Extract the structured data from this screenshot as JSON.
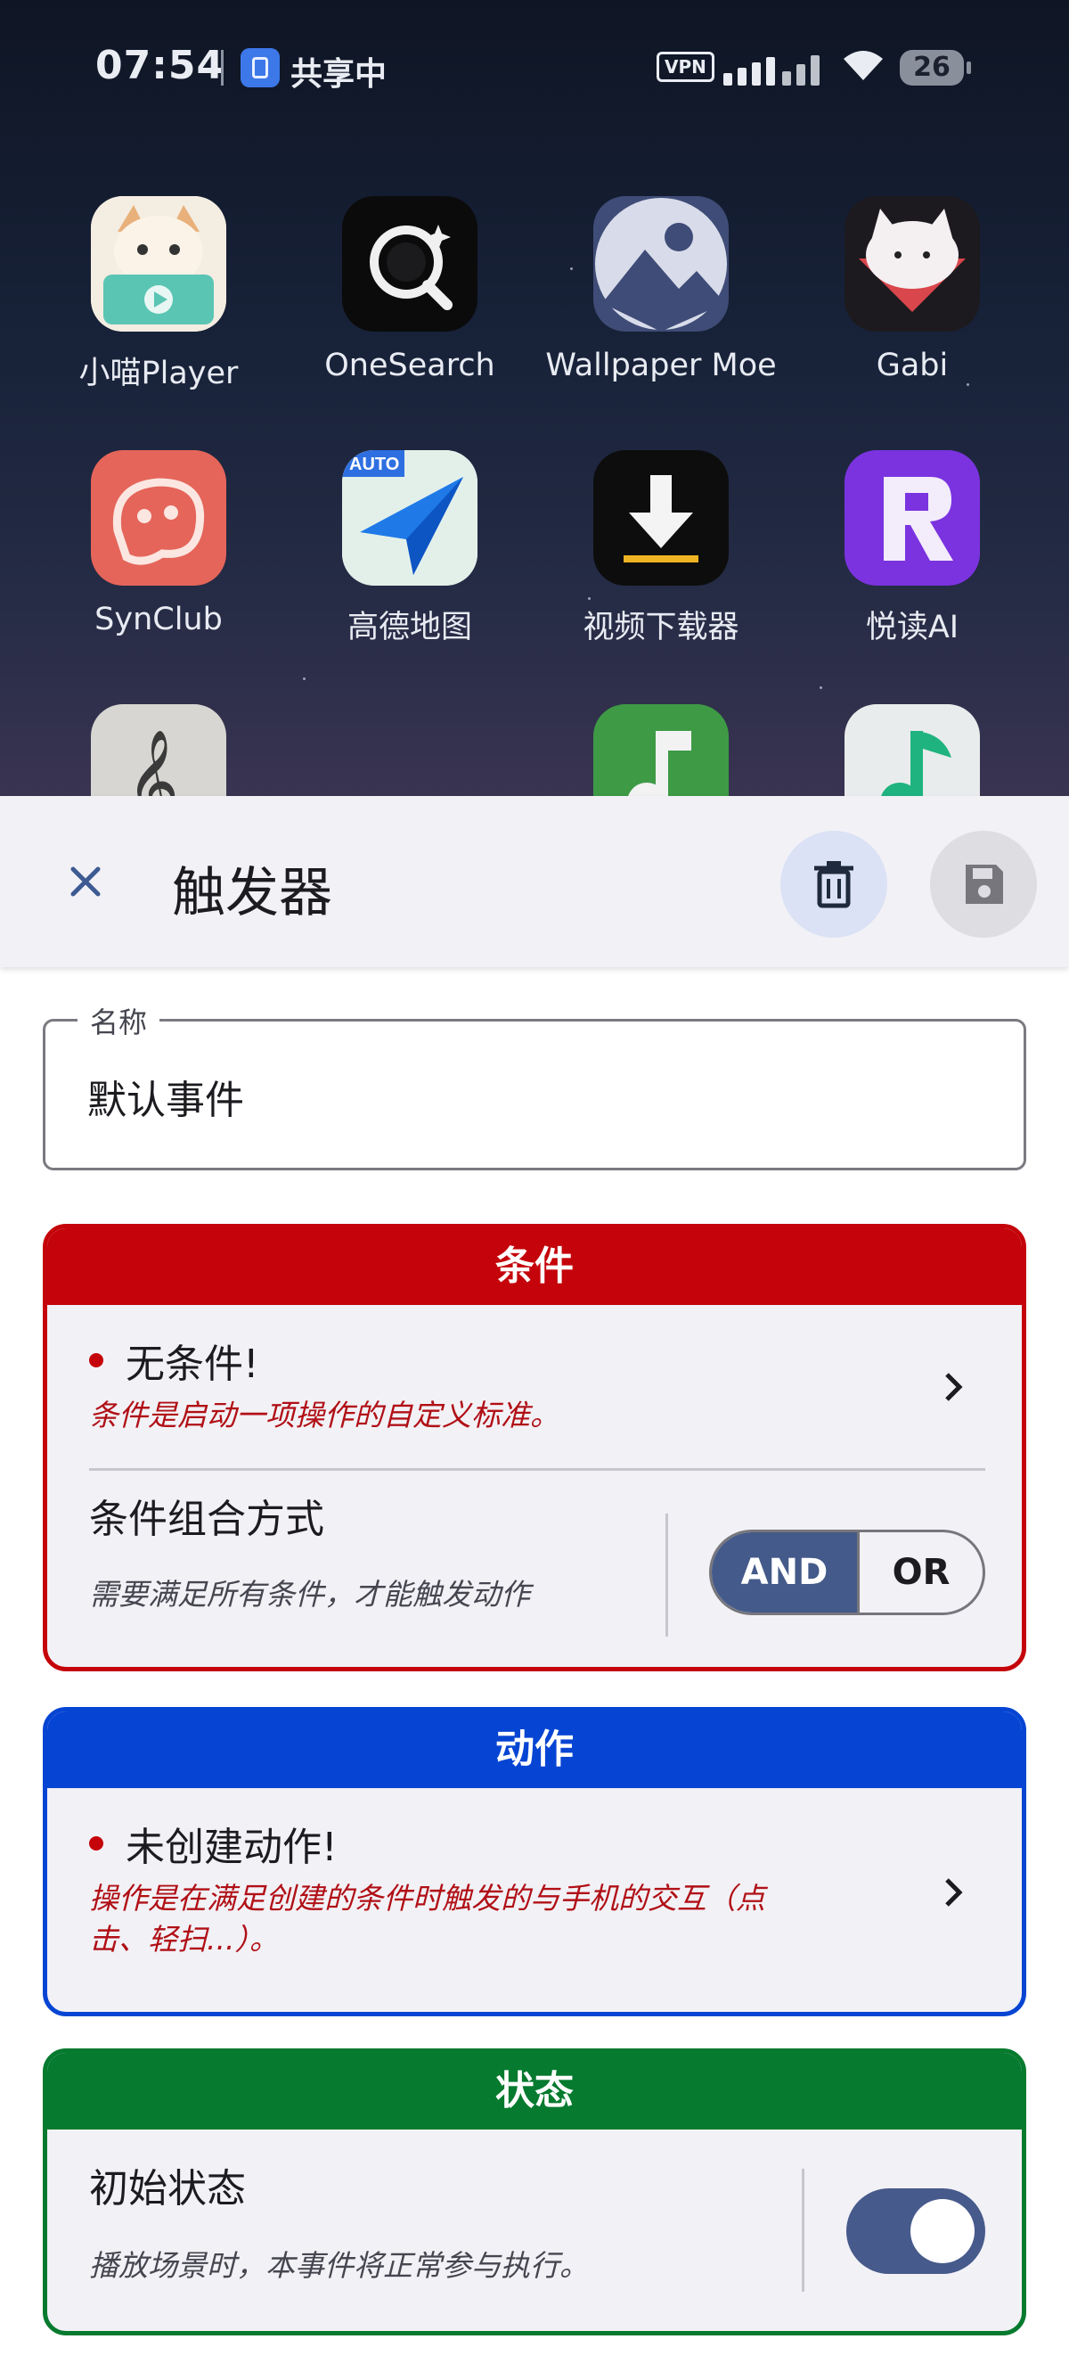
{
  "status_bar": {
    "time": "07:54",
    "sharing_label": "共享中",
    "vpn_label": "VPN",
    "battery_level": "26",
    "icons": [
      "screen-share-icon",
      "vpn-icon",
      "cellular-signal-icon",
      "wifi-icon",
      "battery-icon"
    ]
  },
  "home_screen": {
    "apps_row1": [
      {
        "name": "小喵Player",
        "icon": "cat-player-icon"
      },
      {
        "name": "OneSearch",
        "icon": "onesearch-icon"
      },
      {
        "name": "Wallpaper Moe",
        "icon": "wallpaper-moe-icon"
      },
      {
        "name": "Gabi",
        "icon": "gabi-icon"
      }
    ],
    "apps_row2": [
      {
        "name": "SynClub",
        "icon": "synclub-icon"
      },
      {
        "name": "高德地图",
        "icon": "amap-icon"
      },
      {
        "name": "视频下载器",
        "icon": "video-downloader-icon"
      },
      {
        "name": "悦读AI",
        "icon": "yuedu-ai-icon"
      }
    ],
    "apps_row3_icons": [
      "music-clef-icon",
      "music-note-green-icon",
      "music-note-teal-icon"
    ],
    "auto_badge": "AUTO"
  },
  "sheet": {
    "title": "触发器",
    "name_field": {
      "label": "名称",
      "value": "默认事件"
    },
    "conditions": {
      "header": "条件",
      "empty_title": "无条件!",
      "empty_desc": "条件是启动一项操作的自定义标准。",
      "combine_title": "条件组合方式",
      "combine_desc": "需要满足所有条件，才能触发动作",
      "and_label": "AND",
      "or_label": "OR",
      "selected": "AND"
    },
    "actions": {
      "header": "动作",
      "empty_title": "未创建动作!",
      "empty_desc_line1": "操作是在满足创建的条件时触发的与手机的交互（点",
      "empty_desc_line2": "击、轻扫...）。"
    },
    "state": {
      "header": "状态",
      "initial_title": "初始状态",
      "initial_desc": "播放场景时，本事件将正常参与执行。",
      "enabled": true
    }
  },
  "colors": {
    "conditions_accent": "#c4040a",
    "actions_accent": "#0645d3",
    "state_accent": "#067a2e",
    "toggle_on": "#465a8b"
  }
}
